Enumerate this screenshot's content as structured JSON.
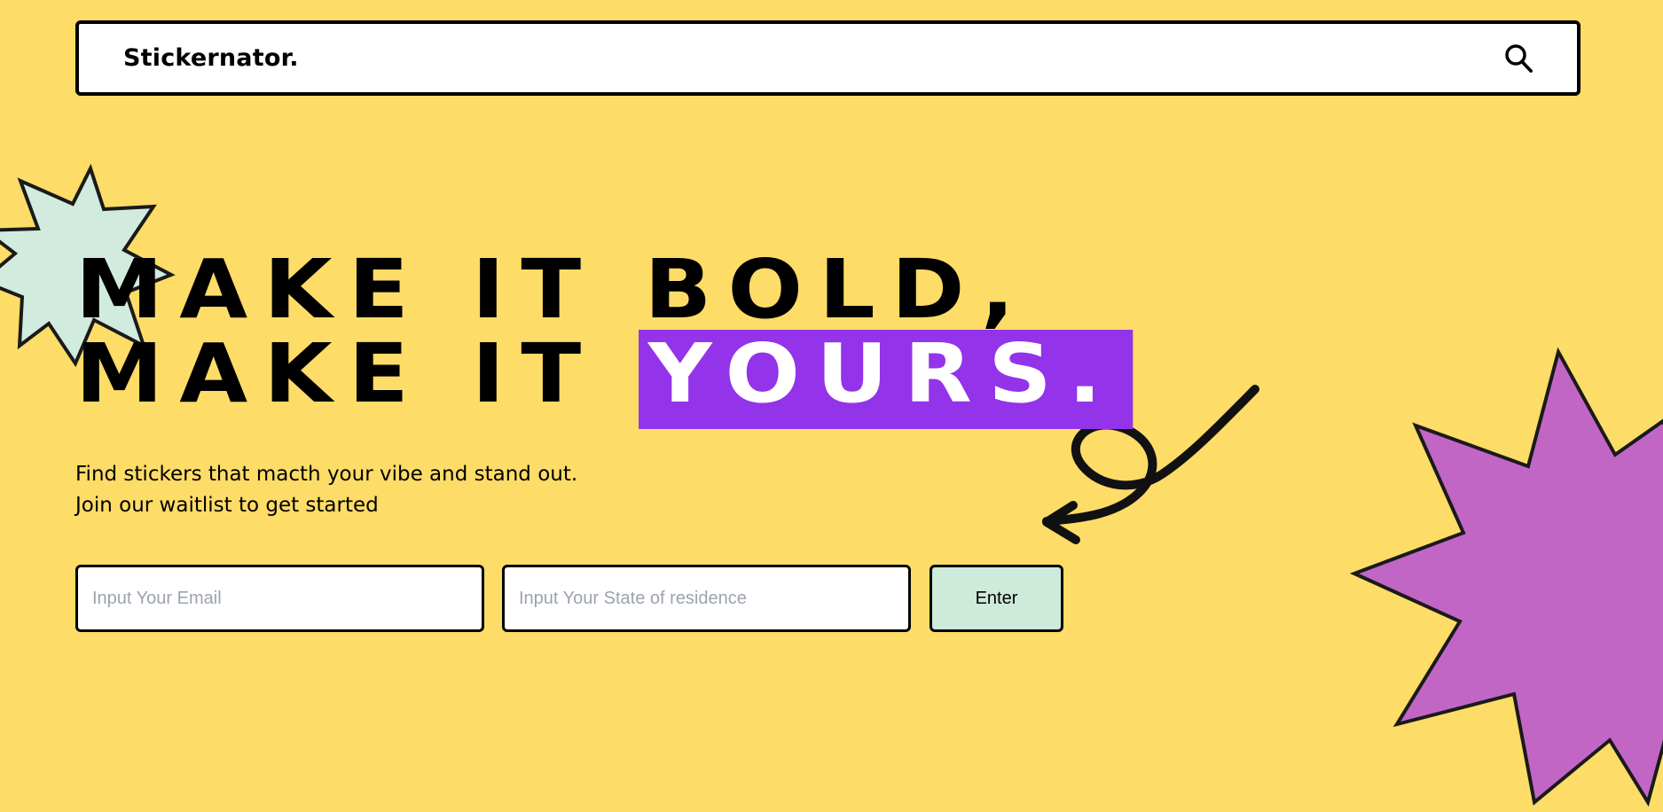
{
  "header": {
    "brand": "Stickernator.",
    "search_icon": "search-icon"
  },
  "hero": {
    "line1": "MAKE IT BOLD,",
    "line2_prefix": "MAKE IT ",
    "line2_highlight": "YOURS."
  },
  "subtitle": {
    "line1": "Find stickers that macth your vibe and stand out.",
    "line2": "Join our waitlist to get started"
  },
  "form": {
    "email_placeholder": "Input Your Email",
    "email_value": "",
    "state_placeholder": "Input Your State of residence",
    "state_value": "",
    "submit_label": "Enter"
  },
  "decorations": {
    "left_star_icon": "starburst-icon",
    "right_star_icon": "starburst-icon",
    "arrow_icon": "squiggle-arrow-icon"
  },
  "colors": {
    "background": "#FDDC67",
    "highlight": "#9333EA",
    "left_star": "#D2EBDF",
    "right_star": "#C266C6",
    "button": "#CDEADB"
  }
}
